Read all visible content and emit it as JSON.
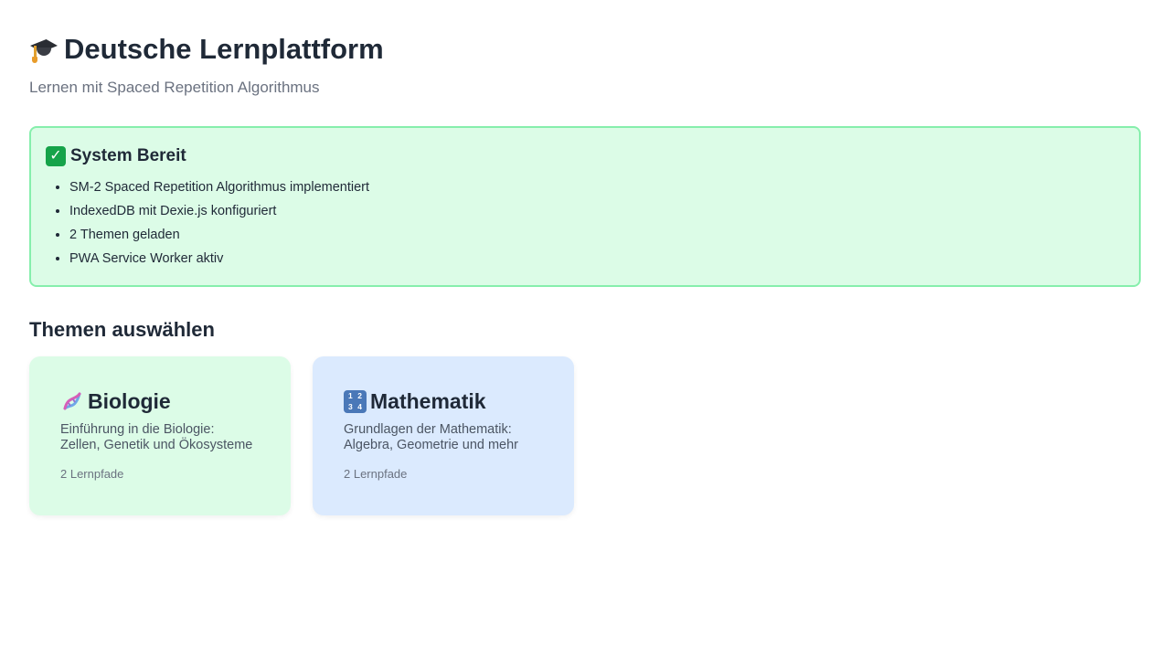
{
  "header": {
    "title": "Deutsche Lernplattform",
    "icon": "graduation-cap-icon",
    "subtitle": "Lernen mit Spaced Repetition Algorithmus"
  },
  "status": {
    "title": "System Bereit",
    "icon": "check-mark-icon",
    "items": [
      "SM-2 Spaced Repetition Algorithmus implementiert",
      "IndexedDB mit Dexie.js konfiguriert",
      "2 Themen geladen",
      "PWA Service Worker aktiv"
    ],
    "background": "#dcfce7",
    "border": "#86efac"
  },
  "topics_section": {
    "title": "Themen auswählen",
    "topics": [
      {
        "title": "Biologie",
        "icon": "dna-icon",
        "description_line1": "Einführung in die Biologie:",
        "description_line2": "Zellen, Genetik und Ökosysteme",
        "meta": "2 Lernpfade",
        "background": "#dcfce7"
      },
      {
        "title": "Mathematik",
        "icon": "numbers-icon",
        "icon_glyphs": [
          "1",
          "2",
          "3",
          "4"
        ],
        "description_line1": "Grundlagen der Mathematik:",
        "description_line2": "Algebra, Geometrie und mehr",
        "meta": "2 Lernpfade",
        "background": "#dbeafe"
      }
    ]
  }
}
